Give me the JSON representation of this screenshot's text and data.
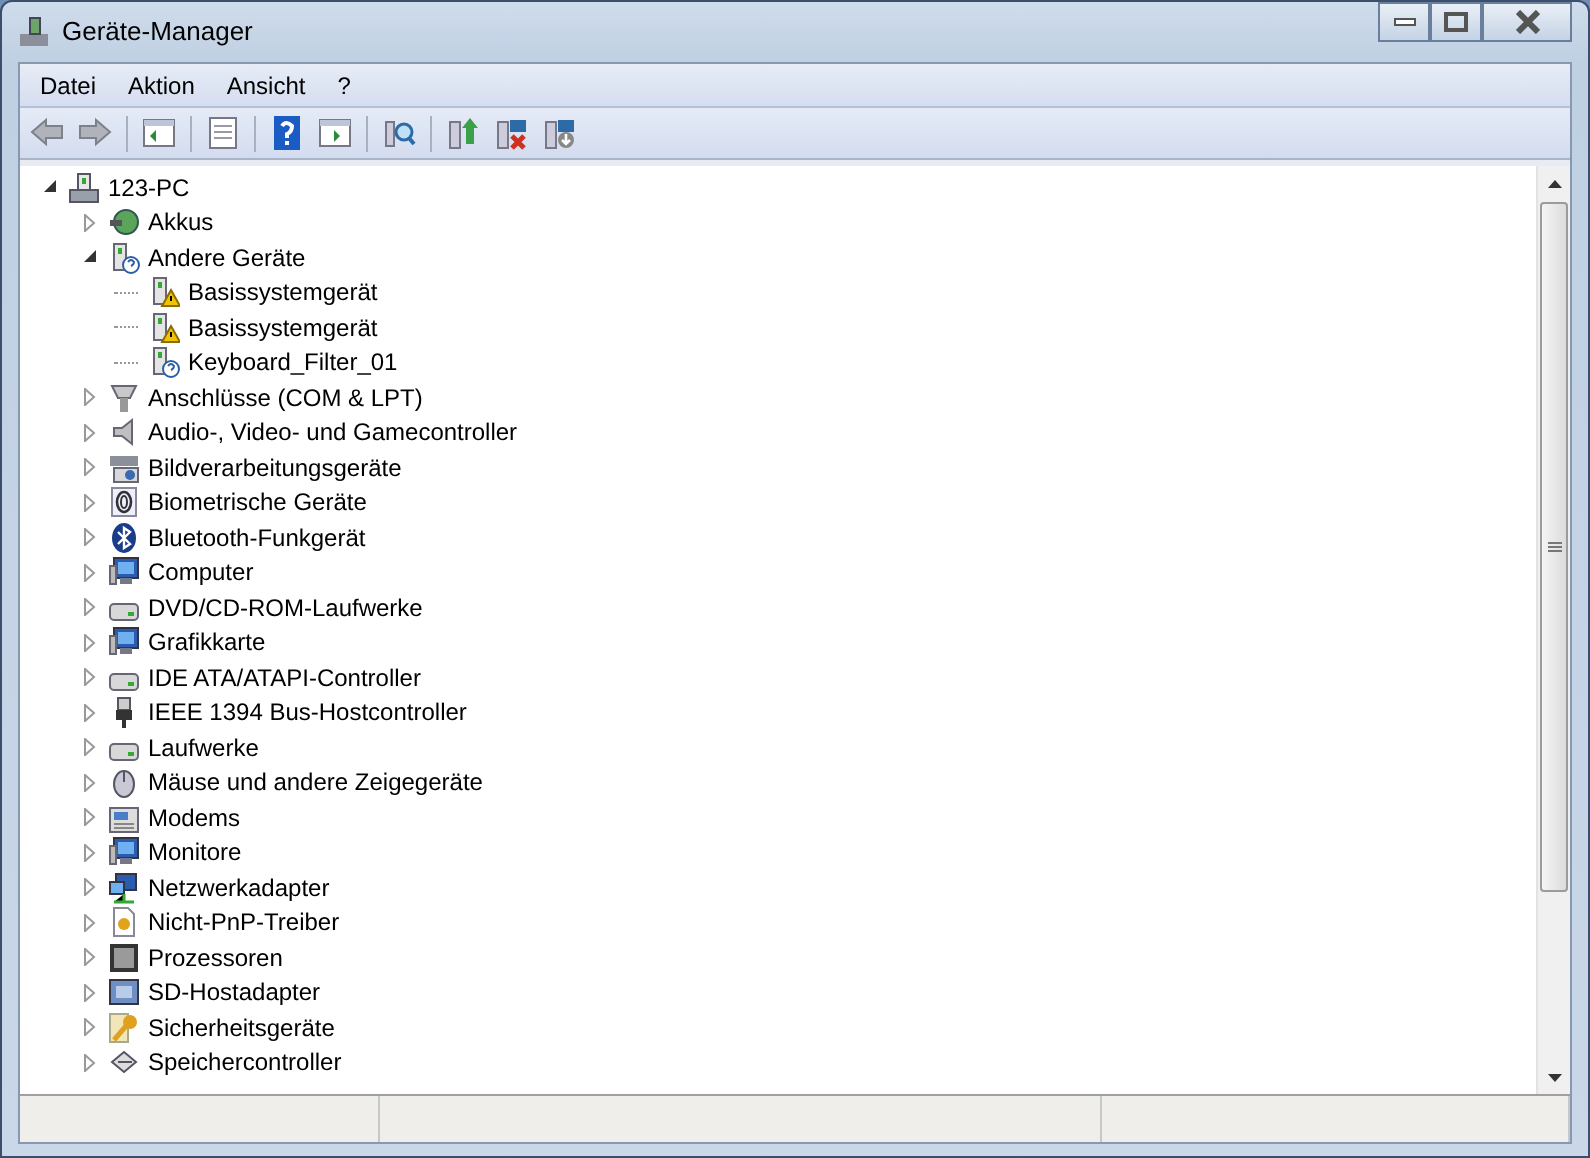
{
  "window": {
    "title": "Geräte-Manager"
  },
  "menu": [
    "Datei",
    "Aktion",
    "Ansicht",
    "?"
  ],
  "tree": {
    "label": "123-PC",
    "kind": "computer",
    "expanded": true,
    "children": [
      {
        "label": "Akkus",
        "kind": "battery",
        "expanded": false
      },
      {
        "label": "Andere Geräte",
        "kind": "unknown",
        "expanded": true,
        "children": [
          {
            "label": "Basissystemgerät",
            "kind": "warning"
          },
          {
            "label": "Basissystemgerät",
            "kind": "warning"
          },
          {
            "label": "Keyboard_Filter_01",
            "kind": "unknown"
          }
        ]
      },
      {
        "label": "Anschlüsse (COM & LPT)",
        "kind": "port",
        "expanded": false
      },
      {
        "label": "Audio-, Video- und Gamecontroller",
        "kind": "speaker",
        "expanded": false
      },
      {
        "label": "Bildverarbeitungsgeräte",
        "kind": "camera",
        "expanded": false
      },
      {
        "label": "Biometrische Geräte",
        "kind": "fingerprint",
        "expanded": false
      },
      {
        "label": "Bluetooth-Funkgerät",
        "kind": "bluetooth",
        "expanded": false
      },
      {
        "label": "Computer",
        "kind": "monitor",
        "expanded": false
      },
      {
        "label": "DVD/CD-ROM-Laufwerke",
        "kind": "drive",
        "expanded": false
      },
      {
        "label": "Grafikkarte",
        "kind": "monitor",
        "expanded": false
      },
      {
        "label": "IDE ATA/ATAPI-Controller",
        "kind": "drive",
        "expanded": false
      },
      {
        "label": "IEEE 1394 Bus-Hostcontroller",
        "kind": "plug",
        "expanded": false
      },
      {
        "label": "Laufwerke",
        "kind": "drive",
        "expanded": false
      },
      {
        "label": "Mäuse und andere Zeigegeräte",
        "kind": "mouse",
        "expanded": false
      },
      {
        "label": "Modems",
        "kind": "modem",
        "expanded": false
      },
      {
        "label": "Monitore",
        "kind": "monitor",
        "expanded": false
      },
      {
        "label": "Netzwerkadapter",
        "kind": "network",
        "expanded": false
      },
      {
        "label": "Nicht-PnP-Treiber",
        "kind": "driver",
        "expanded": false
      },
      {
        "label": "Prozessoren",
        "kind": "chip",
        "expanded": false
      },
      {
        "label": "SD-Hostadapter",
        "kind": "card",
        "expanded": false
      },
      {
        "label": "Sicherheitsgeräte",
        "kind": "key",
        "expanded": false
      },
      {
        "label": "Speichercontroller",
        "kind": "storage",
        "expanded": false
      }
    ]
  }
}
